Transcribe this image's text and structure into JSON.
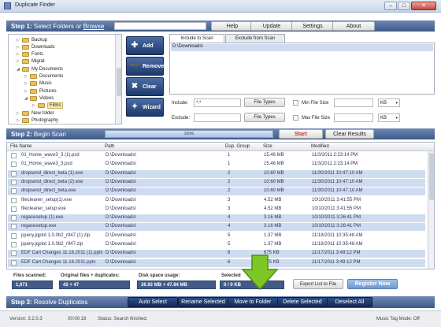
{
  "app": {
    "title": "Duplicate Finder"
  },
  "toolbar": {
    "help": "Help",
    "update": "Update",
    "settings": "Settings",
    "about": "About"
  },
  "step1": {
    "label": "Step 1:",
    "text": "Select Folders or",
    "browse": "Browse"
  },
  "tree": {
    "items": [
      {
        "label": "Backup",
        "indent": 1,
        "expanded": false
      },
      {
        "label": "Downloads",
        "indent": 1,
        "expanded": false
      },
      {
        "label": "Fonts",
        "indent": 1,
        "expanded": false
      },
      {
        "label": "Migrat",
        "indent": 1,
        "expanded": false
      },
      {
        "label": "My Documents",
        "indent": 1,
        "expanded": true
      },
      {
        "label": "Documents",
        "indent": 2,
        "expanded": false
      },
      {
        "label": "Music",
        "indent": 2,
        "expanded": false
      },
      {
        "label": "Pictures",
        "indent": 2,
        "expanded": false
      },
      {
        "label": "Videos",
        "indent": 2,
        "expanded": true
      },
      {
        "label": "Films",
        "indent": 3,
        "expanded": false
      },
      {
        "label": "New folder",
        "indent": 1,
        "expanded": false
      },
      {
        "label": "Photography",
        "indent": 1,
        "expanded": false
      }
    ]
  },
  "side_buttons": {
    "add": "Add",
    "remove": "Remove",
    "clear": "Clear",
    "wizard": "Wizard"
  },
  "tabs": {
    "include": "Include to Scan",
    "exclude": "Exclude from Scan"
  },
  "include_paths": [
    "D:\\Downloads\\"
  ],
  "filters": {
    "include_label": "Include:",
    "include_value": "*.*",
    "exclude_label": "Exclude:",
    "exclude_value": "",
    "file_types": "File Types",
    "min_size_label": "Min File Size",
    "max_size_label": "Max File Size",
    "min_unit": "KB",
    "max_unit": "KB"
  },
  "step2": {
    "label": "Step 2:",
    "text": "Begin Scan",
    "progress": 100,
    "progress_label": "100%",
    "start": "Start",
    "clear_results": "Clear Results"
  },
  "columns": {
    "file_name": "File Name",
    "path": "Path",
    "dup_group": "Dup. Group",
    "size": "Size",
    "modified": "Modified"
  },
  "files": [
    {
      "name": "01_Home_wave3_3 (1).psd",
      "path": "D:\\Downloads\\",
      "group": "1",
      "size": "15.46 MB",
      "modified": "11/3/2011 2:23:14 PM",
      "selected": false
    },
    {
      "name": "01_Home_wave3_3.psd",
      "path": "D:\\Downloads\\",
      "group": "1",
      "size": "15.46 MB",
      "modified": "11/3/2011 2:23:14 PM",
      "selected": false
    },
    {
      "name": "dropsend_direct_beta (1).exe",
      "path": "D:\\Downloads\\",
      "group": "2",
      "size": "10.60 MB",
      "modified": "11/30/2011 10:47:10 AM",
      "selected": true
    },
    {
      "name": "dropsend_direct_beta (2).exe",
      "path": "D:\\Downloads\\",
      "group": "2",
      "size": "10.60 MB",
      "modified": "11/30/2011 10:47:10 AM",
      "selected": true
    },
    {
      "name": "dropsend_direct_beta.exe",
      "path": "D:\\Downloads\\",
      "group": "2",
      "size": "10.60 MB",
      "modified": "11/30/2011 10:47:10 AM",
      "selected": true
    },
    {
      "name": "filecleaner_setup(1).exe",
      "path": "D:\\Downloads\\",
      "group": "3",
      "size": "4.52 MB",
      "modified": "10/10/2011 3:41:55 PM",
      "selected": false
    },
    {
      "name": "filecleaner_setup.exe",
      "path": "D:\\Downloads\\",
      "group": "3",
      "size": "4.52 MB",
      "modified": "10/10/2011 3:41:55 PM",
      "selected": false
    },
    {
      "name": "regacesetup (1).exe",
      "path": "D:\\Downloads\\",
      "group": "4",
      "size": "3.16 MB",
      "modified": "10/10/2011 3:26:41 PM",
      "selected": true
    },
    {
      "name": "regacesetup.exe",
      "path": "D:\\Downloads\\",
      "group": "4",
      "size": "3.16 MB",
      "modified": "10/10/2011 3:26:41 PM",
      "selected": true
    },
    {
      "name": "jquery.jqplot.1.0.0b2_r947 (1).zip",
      "path": "D:\\Downloads\\",
      "group": "5",
      "size": "1.37 MB",
      "modified": "11/18/2011 10:35:48 AM",
      "selected": false
    },
    {
      "name": "jquery.jqplot.1.0.0b2_r947.zip",
      "path": "D:\\Downloads\\",
      "group": "5",
      "size": "1.37 MB",
      "modified": "11/18/2011 10:35:48 AM",
      "selected": false
    },
    {
      "name": "EDF Cart Changes 11.16.2011 (1).pptx",
      "path": "D:\\Downloads\\",
      "group": "6",
      "size": "675 KB",
      "modified": "11/17/2011 3:49:12 PM",
      "selected": true
    },
    {
      "name": "EDF Cart Changes 11.16.2011.pptx",
      "path": "D:\\Downloads\\",
      "group": "6",
      "size": "675 KB",
      "modified": "11/17/2011 3:49:12 PM",
      "selected": true
    }
  ],
  "stats": {
    "scanned_label": "Files scanned:",
    "scanned_value": "1,071",
    "original_label": "Original files + duplicates:",
    "original_value": "42 + 47",
    "disk_label": "Disk space usage:",
    "disk_value": "36.92 MB + 47.84 MB",
    "selected_label": "Selected",
    "selected_value": "0 / 0 KB",
    "export": "Export List to File",
    "register": "Register Now"
  },
  "step3": {
    "label": "Step 3:",
    "text": "Resolve Duplicates",
    "auto_select": "Auto Select",
    "rename": "Rename Selected",
    "move": "Move to Folder",
    "delete": "Delete Selected",
    "deselect": "Deselect All"
  },
  "status": {
    "version": "Version: 3.2.0.3",
    "time": "00:00:18",
    "message": "Status: Search finished.",
    "tag_mode": "Music Tag Mode: Off"
  },
  "colors": {
    "accent": "#3f5a89",
    "selected_row": "#cfdcf0",
    "arrow": "#7dc626",
    "start_text": "#d03030"
  }
}
